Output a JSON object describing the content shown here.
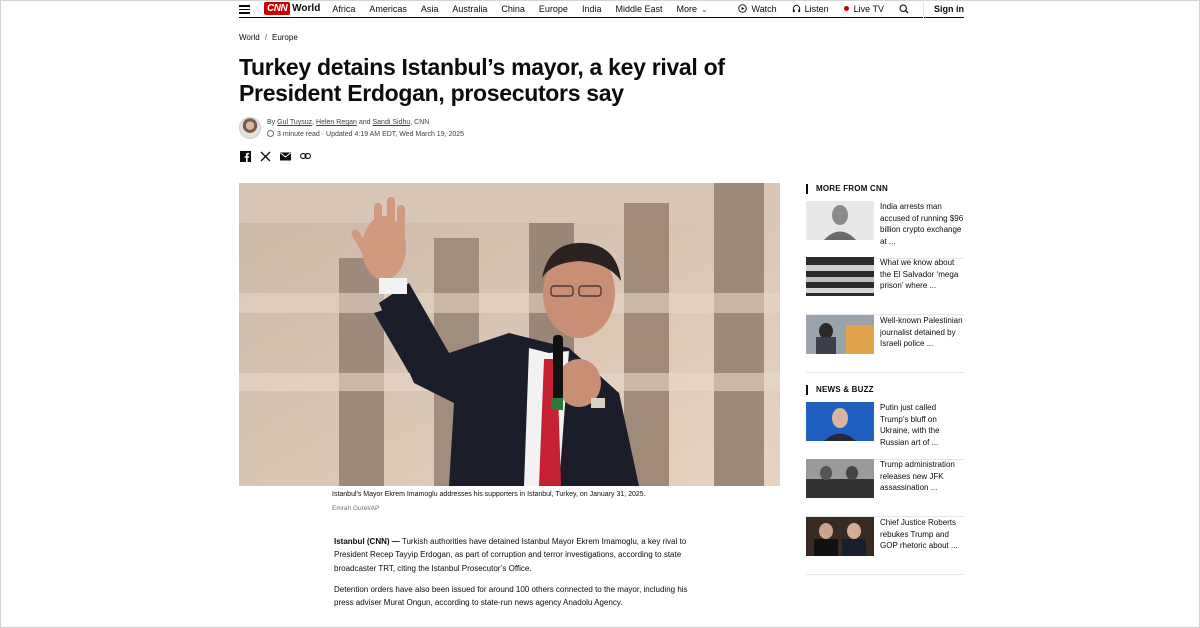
{
  "nav": {
    "logo": "CNN",
    "section": "World",
    "items": [
      "Africa",
      "Americas",
      "Asia",
      "Australia",
      "China",
      "Europe",
      "India",
      "Middle East",
      "More"
    ],
    "watch": "Watch",
    "listen": "Listen",
    "live_tv": "Live TV",
    "sign_in": "Sign in"
  },
  "breadcrumb": [
    "World",
    "Europe"
  ],
  "headline": "Turkey detains Istanbul’s mayor, a key rival of President Erdogan, prosecutors say",
  "byline": {
    "prefix": "By",
    "author1": "Gul Tuysuz",
    "author2": "Helen Regan",
    "and": "and",
    "author3": "Sandi Sidhu",
    "outlet": ", CNN",
    "read_time": "3 minute read",
    "updated": "Updated 4:19 AM EDT, Wed March 19, 2025"
  },
  "hero": {
    "caption": "Istanbul's Mayor Ekrem Imamoglu addresses his supporters in Istanbul, Turkey, on January 31, 2025.",
    "credit": "Emrah Gurel/AP"
  },
  "body": {
    "dateline": "Istanbul (CNN) —",
    "p1": " Turkish authorities have detained Istanbul Mayor Ekrem Imamoglu, a key rival to President Recep Tayyip Erdogan, as part of corruption and terror investigations, according to state broadcaster TRT, citing the Istanbul Prosecutor’s Office.",
    "p2": "Detention orders have also been issued for around 100 others connected to the mayor, including his press adviser Murat Ongun, according to state-run news agency Anadolu Agency."
  },
  "sidebar": {
    "more_title": "MORE FROM CNN",
    "more": [
      {
        "headline": "India arrests man accused of running $96 billion crypto exchange at ..."
      },
      {
        "headline": "What we know about the El Salvador ‘mega prison’ where ..."
      },
      {
        "headline": "Well-known Palestinian journalist detained by Israeli police ..."
      }
    ],
    "news_title": "NEWS & BUZZ",
    "news": [
      {
        "headline": "Putin just called Trump’s bluff on Ukraine, with the Russian art of ..."
      },
      {
        "headline": "Trump administration releases new JFK assassination ..."
      },
      {
        "headline": "Chief Justice Roberts rebukes Trump and GOP rhetoric about ..."
      }
    ]
  },
  "colors": {
    "brand_red": "#cc0000",
    "text": "#0c0c0c",
    "muted": "#6e6e6e"
  }
}
